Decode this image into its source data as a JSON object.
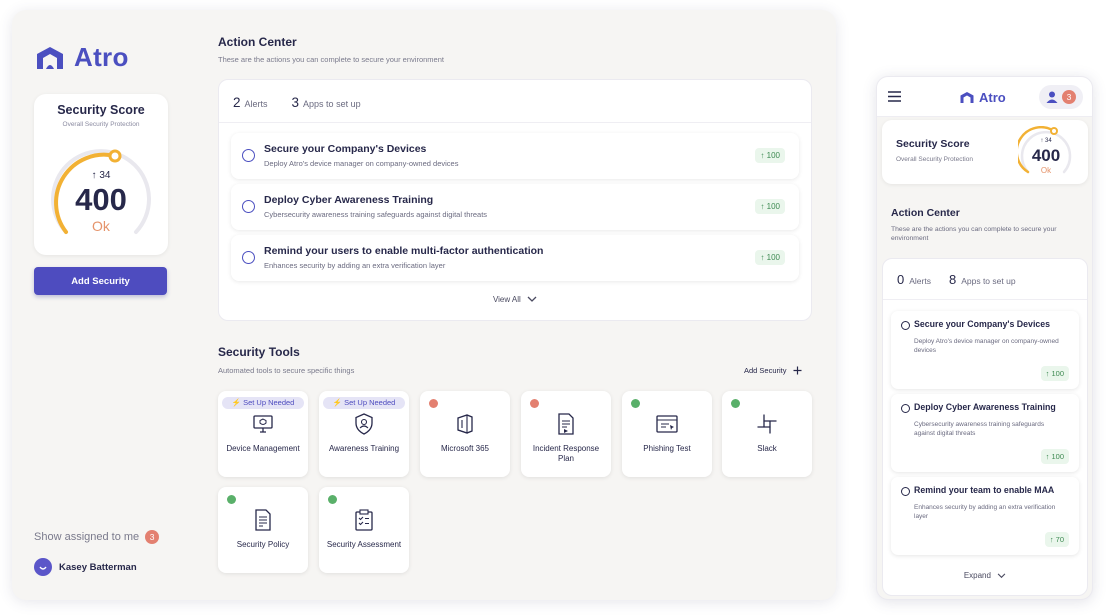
{
  "brand": {
    "name": "Atro",
    "accent": "#4e4cbf"
  },
  "sidebar": {
    "score_card": {
      "title": "Security Score",
      "subtitle": "Overall Security Protection",
      "delta": "34",
      "value": "400",
      "status": "Ok",
      "level": 0.62
    },
    "add_security_label": "Add Security",
    "assigned": {
      "label": "Show assigned to me",
      "count": "3"
    },
    "user": {
      "name": "Kasey Batterman"
    }
  },
  "action_center": {
    "title": "Action Center",
    "subtitle": "These are the actions you can complete to secure your environment",
    "tabs": [
      {
        "count": "2",
        "label": "Alerts"
      },
      {
        "count": "3",
        "label": "Apps to set up"
      }
    ],
    "items": [
      {
        "title": "Secure your Company's Devices",
        "desc": "Deploy Atro's device manager on company-owned devices",
        "points": "100"
      },
      {
        "title": "Deploy Cyber Awareness Training",
        "desc": "Cybersecurity awareness training safeguards against digital threats",
        "points": "100"
      },
      {
        "title": "Remind your users to enable multi-factor authentication",
        "desc": "Enhances security by adding an extra verification layer",
        "points": "100"
      }
    ],
    "view_all": "View All"
  },
  "security_tools": {
    "title": "Security Tools",
    "subtitle": "Automated tools to secure specific things",
    "add_label": "Add Security",
    "setup_label": "Set Up Needed",
    "tools": [
      {
        "label": "Device Management",
        "status": "setup",
        "icon": "device-icon"
      },
      {
        "label": "Awareness Training",
        "status": "setup",
        "icon": "shield-user-icon"
      },
      {
        "label": "Microsoft 365",
        "status": "alert",
        "icon": "office-icon"
      },
      {
        "label": "Incident Response Plan",
        "status": "alert",
        "icon": "document-icon"
      },
      {
        "label": "Phishing Test",
        "status": "ok",
        "icon": "browser-icon"
      },
      {
        "label": "Slack",
        "status": "ok",
        "icon": "slack-icon"
      },
      {
        "label": "Security Policy",
        "status": "ok",
        "icon": "policy-icon"
      },
      {
        "label": "Security Assessment",
        "status": "ok",
        "icon": "clipboard-icon"
      }
    ]
  },
  "mobile": {
    "header": {
      "logo": "Atro",
      "badge": "3"
    },
    "score_card": {
      "title": "Security Score",
      "subtitle": "Overall Security Protection",
      "delta": "34",
      "value": "400",
      "status": "Ok"
    },
    "action_center": {
      "title": "Action Center",
      "subtitle": "These are the actions you can complete to secure your environment",
      "tabs": [
        {
          "count": "0",
          "label": "Alerts"
        },
        {
          "count": "8",
          "label": "Apps to set up"
        }
      ],
      "items": [
        {
          "title": "Secure your Company's Devices",
          "desc": "Deploy Atro's device manager on company-owned devices",
          "points": "100"
        },
        {
          "title": "Deploy Cyber Awareness Training",
          "desc": "Cybersecurity awareness training safeguards against digital threats",
          "points": "100"
        },
        {
          "title": "Remind your team to enable MAA",
          "desc": "Enhances security by adding an extra verification layer",
          "points": "70"
        }
      ],
      "expand": "Expand"
    }
  },
  "colors": {
    "warning": "#f2b134",
    "alert": "#e38070",
    "success": "#5ab06a",
    "points_bg": "#eaf6ec"
  }
}
